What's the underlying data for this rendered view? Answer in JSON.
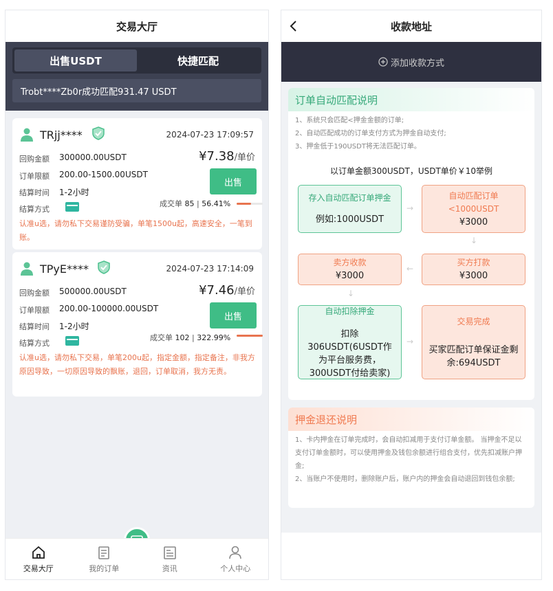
{
  "left": {
    "title": "交易大厅",
    "tabs": [
      "出售USDT",
      "快捷匹配"
    ],
    "ticker": "Trobt****Zb0r成功匹配931.47 USDT",
    "labels": {
      "buyback": "回购金额",
      "limit": "订单限额",
      "settle_time": "结算时间",
      "settle_method": "结算方式",
      "unit": "/单价",
      "deals": "成交单",
      "sell": "出售"
    },
    "listings": [
      {
        "user": "TRjj****",
        "date": "2024-07-23 17:09:57",
        "buyback": "300000.00USDT",
        "limit": "200.00-1500.00USDT",
        "time": "1-2小时",
        "price": "¥7.38",
        "deals": "85",
        "rate": "56.41%",
        "rate_value": 0.5641,
        "note": "认准u选，请勿私下交易谨防受骗，单笔1500u起，高速安全，一笔到账。"
      },
      {
        "user": "TPyE****",
        "date": "2024-07-23 17:14:09",
        "buyback": "500000.00USDT",
        "limit": "200.00-100000.00USDT",
        "time": "1-2小时",
        "price": "¥7.46",
        "deals": "102",
        "rate": "322.99%",
        "rate_value": 1.0,
        "note": "认准u选，请勿私下交易，单笔200u起，指定金额，指定备注，非我方原因导致，一切原因导致的飘账，退回，订单取消，我方无责。"
      }
    ],
    "nav": [
      "交易大厅",
      "我的订单",
      "资讯",
      "个人中心"
    ]
  },
  "right": {
    "title": "收款地址",
    "add_method": "添加收款方式",
    "auto_title": "订单自动匹配说明",
    "auto_desc": [
      "1、系统只会匹配<押金金额的订单;",
      "2、自动匹配成功的订单支付方式为押金自动支付;",
      "3、押金低于190USDT将无法匹配订单。"
    ],
    "example_title": "以订单金额300USDT，USDT单价￥10举例",
    "flow": {
      "b1_title": "存入自动匹配订单押金",
      "b1_text": "例如:1000USDT",
      "b2_title": "自动匹配订单<1000USDT",
      "b2_text": "¥3000",
      "b3_title": "卖方收款",
      "b3_text": "¥3000",
      "b4_title": "买方打款",
      "b4_text": "¥3000",
      "b5_title": "自动扣除押金",
      "b5_text": "扣除306USDT(6USDT作为平台服务费，300USDT付给卖家)",
      "b6_title": "交易完成",
      "b6_text": "买家匹配订单保证金剩余:694USDT"
    },
    "refund_title": "押金退还说明",
    "refund_desc": [
      "1、卡内押金在订单完成时，会自动扣减用于支付订单金额。 当押金不足以支付订单金额时，可以使用押金及钱包余额进行组合支付，优先扣减账户押金;",
      "2、当账户不使用时，删除账户后，账户内的押金会自动退回到钱包余额;"
    ]
  },
  "colors": {
    "accent": "#3fbd86",
    "warn": "#e8744f",
    "dark": "#3d4152"
  }
}
